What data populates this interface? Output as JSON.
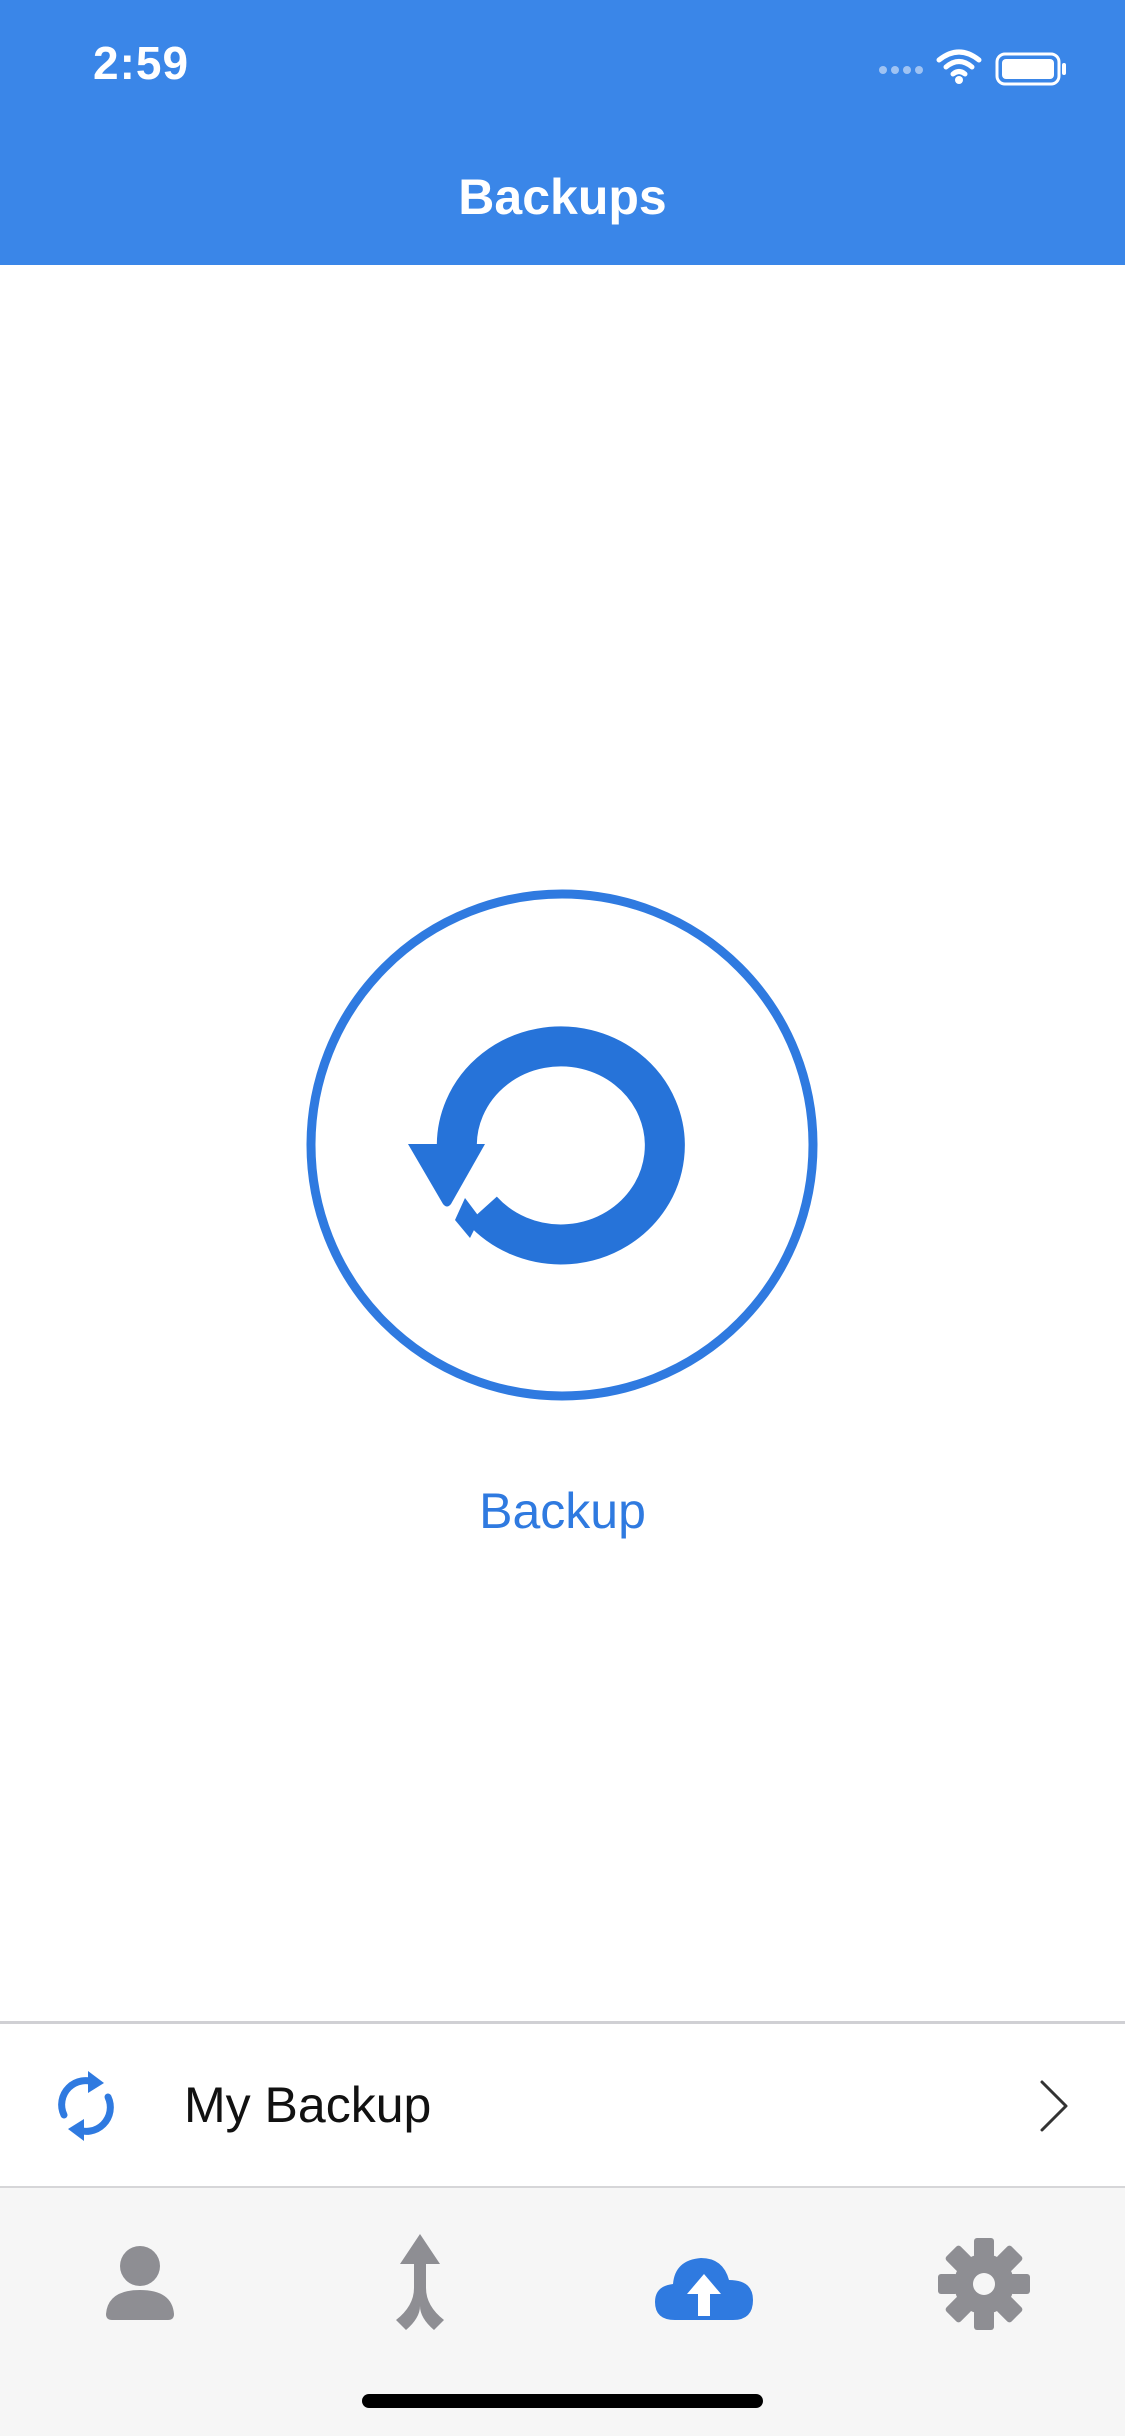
{
  "status_bar": {
    "time": "2:59"
  },
  "nav": {
    "title": "Backups"
  },
  "main": {
    "backup_button_label": "Backup"
  },
  "list": {
    "items": [
      {
        "label": "My Backup",
        "icon": "sync-icon"
      }
    ]
  },
  "tabbar": {
    "tabs": [
      {
        "icon": "person-icon",
        "selected": false
      },
      {
        "icon": "merge-arrow-icon",
        "selected": false
      },
      {
        "icon": "cloud-upload-icon",
        "selected": true
      },
      {
        "icon": "gear-icon",
        "selected": false
      }
    ]
  },
  "colors": {
    "header": "#3a86e8",
    "accent": "#2f7ae0",
    "tab_inactive": "#8e8e93",
    "tab_active": "#2f7ae0"
  }
}
